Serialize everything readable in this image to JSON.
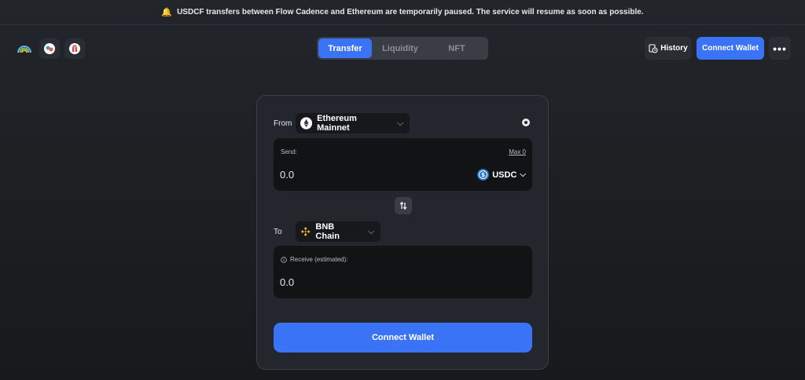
{
  "banner": {
    "text": "USDCF transfers between Flow Cadence and Ethereum are temporarily paused. The service will resume as soon as possible."
  },
  "header": {
    "tabs": [
      {
        "label": "Transfer",
        "active": true
      },
      {
        "label": "Liquidity",
        "active": false
      },
      {
        "label": "NFT",
        "active": false
      }
    ],
    "history_label": "History",
    "connect_label": "Connect Wallet"
  },
  "transfer": {
    "from_label": "From",
    "from_chain": "Ethereum Mainnet",
    "send_label": "Send:",
    "max_label": "Max 0",
    "send_amount": "0.0",
    "token": "USDC",
    "to_label": "To",
    "to_chain": "BNB Chain",
    "receive_label": "Receive (estimated):",
    "receive_amount": "0.0",
    "connect_label": "Connect Wallet"
  },
  "colors": {
    "accent": "#3b73f6",
    "background": "#1e2024",
    "card": "#23262c",
    "input": "#121315",
    "warning": "#f5b82e"
  }
}
